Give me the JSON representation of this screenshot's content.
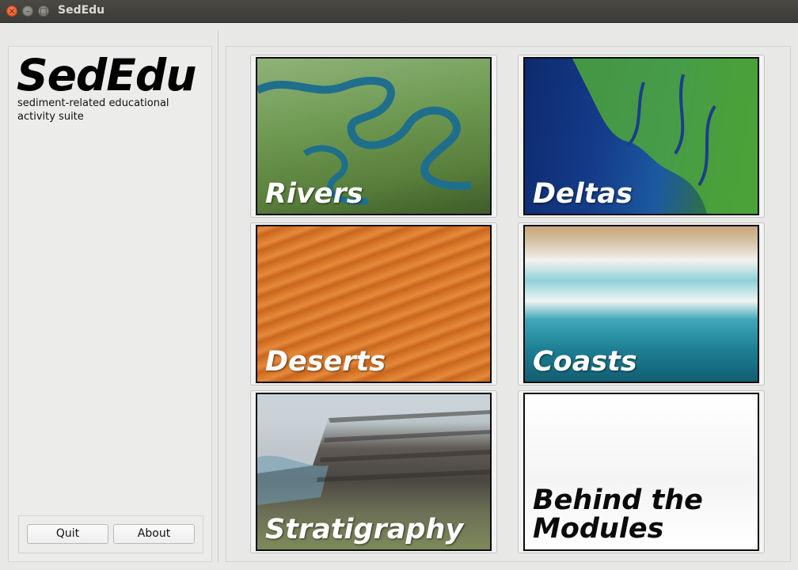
{
  "window": {
    "title": "SedEdu",
    "close_glyph": "×",
    "minimize_glyph": "–",
    "maximize_glyph": "□"
  },
  "sidebar": {
    "logo": "SedEdu",
    "subtitle": "sediment-related educational activity suite",
    "buttons": {
      "quit": "Quit",
      "about": "About"
    }
  },
  "modules": [
    {
      "label": "Rivers",
      "image": "meandering-river-aerial"
    },
    {
      "label": "Deltas",
      "image": "delta-satellite"
    },
    {
      "label": "Deserts",
      "image": "sand-ripples"
    },
    {
      "label": "Coasts",
      "image": "coast-waves-aerial"
    },
    {
      "label": "Stratigraphy",
      "image": "layered-sea-cliff"
    },
    {
      "label_line1": "Behind the",
      "label_line2": "Modules",
      "image": "blank-white"
    }
  ]
}
